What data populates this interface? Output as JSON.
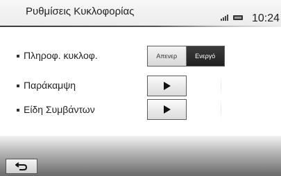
{
  "header": {
    "title": "Ρυθμίσεις Κυκλοφορίας",
    "clock": "10:24"
  },
  "settings": {
    "items": [
      {
        "label": "Πληροφ. κυκλοφ.",
        "toggle": {
          "off_label": "Απενερ",
          "on_label": "Ενεργό",
          "selected": "Ενεργό"
        }
      },
      {
        "label": "Παράκαμψη"
      },
      {
        "label": "Είδη Συμβάντων"
      }
    ]
  },
  "icons": {
    "signal": "signal-strength-icon",
    "battery": "battery-icon",
    "play": "play-arrow-icon",
    "back": "back-arrow-icon"
  },
  "colors": {
    "selected_segment": "#2a2a2a",
    "text": "#222222"
  }
}
